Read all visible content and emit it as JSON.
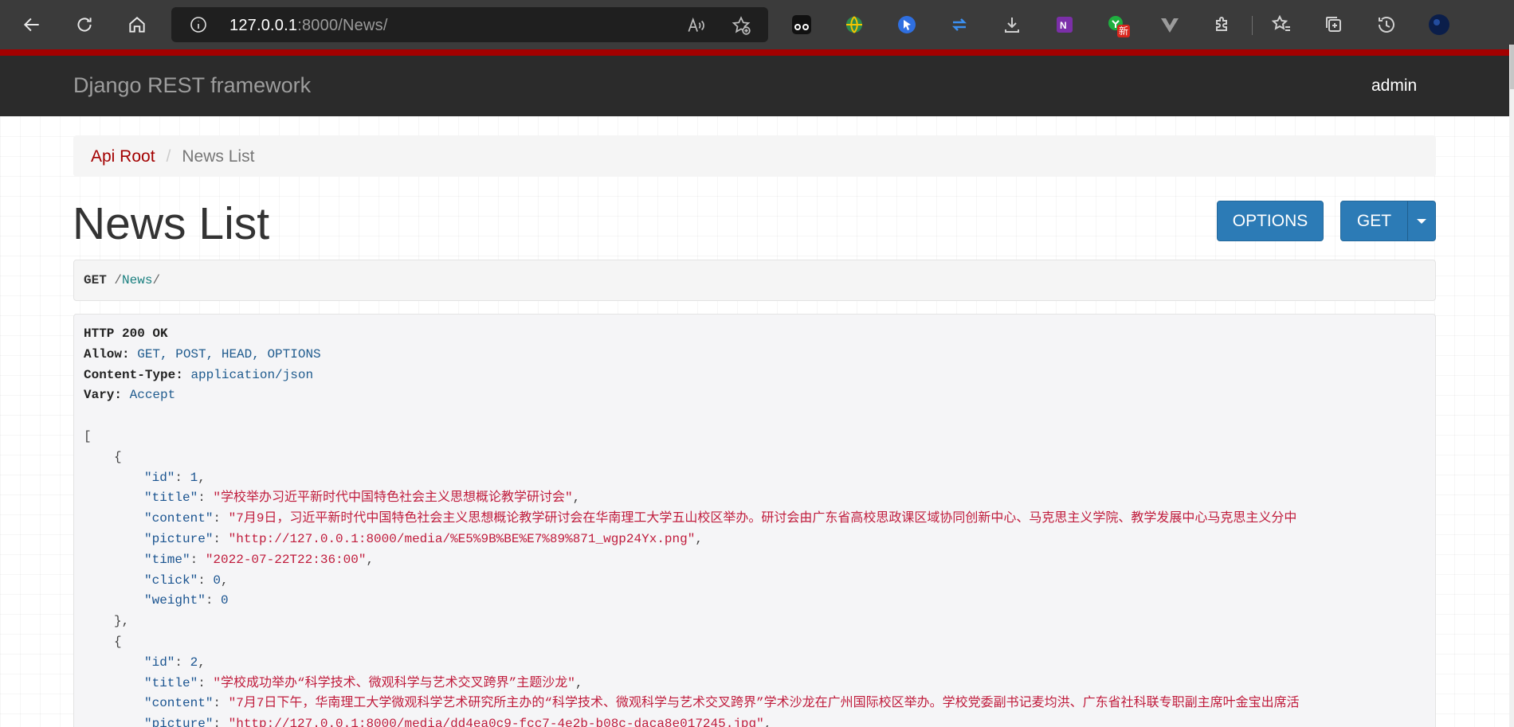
{
  "browser": {
    "url_host": "127.0.0.1",
    "url_rest": ":8000/News/",
    "ext_badge": "新"
  },
  "navbar": {
    "brand": "Django REST framework",
    "user": "admin"
  },
  "breadcrumb": {
    "root": "Api Root",
    "separator": "/",
    "current": "News List"
  },
  "page": {
    "title": "News List",
    "options_label": "OPTIONS",
    "get_label": "GET"
  },
  "request": {
    "method": "GET",
    "slash_start": "/",
    "path": "News",
    "slash_end": "/"
  },
  "response": {
    "status": "HTTP 200 OK",
    "headers": [
      {
        "key": "Allow:",
        "value": "GET, POST, HEAD, OPTIONS"
      },
      {
        "key": "Content-Type:",
        "value": "application/json"
      },
      {
        "key": "Vary:",
        "value": "Accept"
      }
    ],
    "items": [
      {
        "id": "1",
        "title": "\"学校举办习近平新时代中国特色社会主义思想概论教学研讨会\"",
        "content": "\"7月9日，习近平新时代中国特色社会主义思想概论教学研讨会在华南理工大学五山校区举办。研讨会由广东省高校思政课区域协同创新中心、马克思主义学院、教学发展中心马克思主义分中",
        "picture": "\"http://127.0.0.1:8000/media/%E5%9B%BE%E7%89%871_wgp24Yx.png\"",
        "time": "\"2022-07-22T22:36:00\"",
        "click": "0",
        "weight": "0"
      },
      {
        "id": "2",
        "title": "\"学校成功举办“科学技术、微观科学与艺术交叉跨界”主题沙龙\"",
        "content": "\"7月7日下午，华南理工大学微观科学艺术研究所主办的“科学技术、微观科学与艺术交叉跨界”学术沙龙在广州国际校区举办。学校党委副书记麦均洪、广东省社科联专职副主席叶金宝出席活",
        "picture": "\"http://127.0.0.1:8000/media/dd4ea0c9-fcc7-4e2b-b08c-daca8e017245.jpg\""
      }
    ]
  }
}
